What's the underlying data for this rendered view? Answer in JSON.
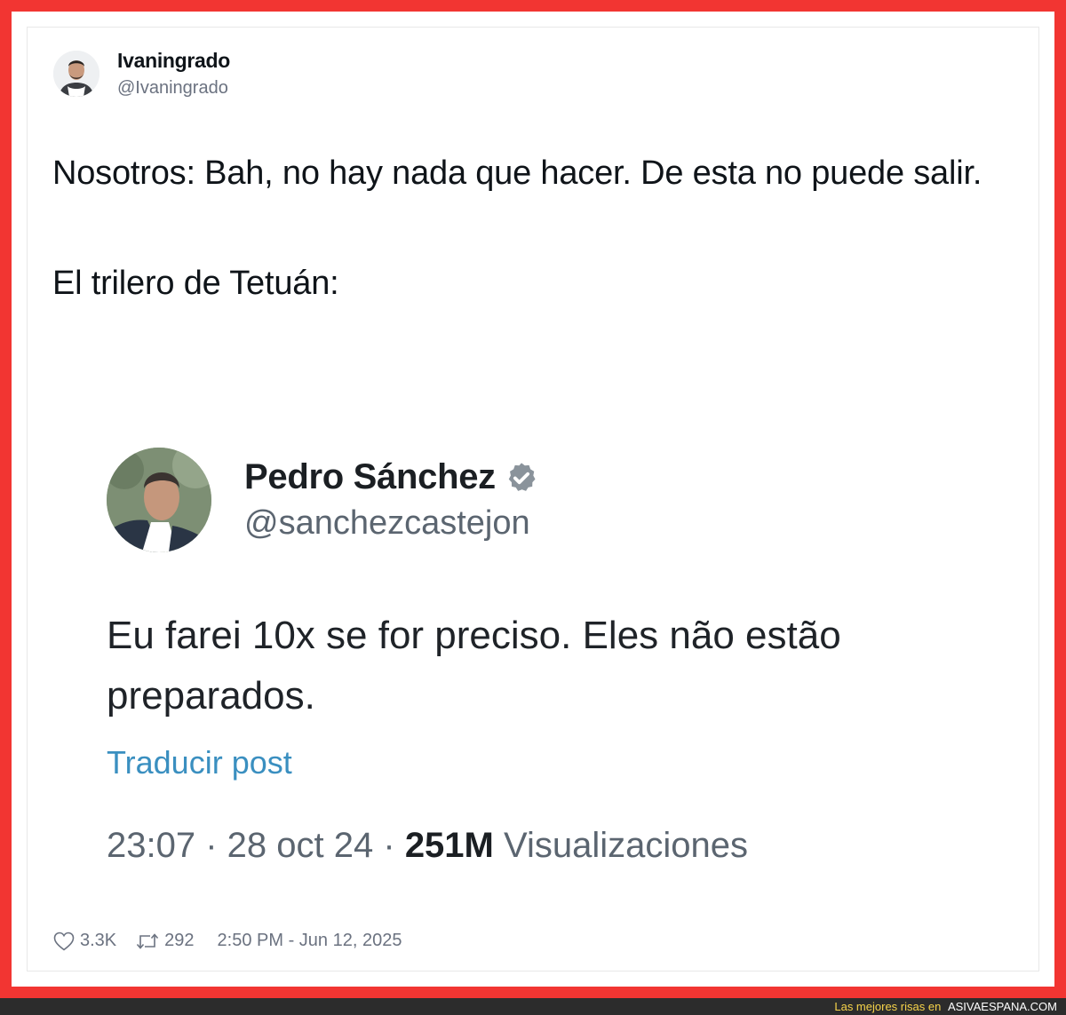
{
  "author": {
    "name": "Ivaningrado",
    "handle": "@Ivaningrado"
  },
  "tweet": {
    "line1": "Nosotros: Bah, no hay nada que hacer. De esta no puede salir.",
    "line2": "El trilero de Tetuán:"
  },
  "embedded_post": {
    "name": "Pedro Sánchez",
    "handle": "@sanchezcastejon",
    "text": "Eu farei 10x se for preciso. Eles não estão preparados.",
    "translate_label": "Traducir post",
    "time": "23:07",
    "date": "28 oct 24",
    "views_count": "251M",
    "views_label": "Visualizaciones",
    "verified_icon": "verified-badge-icon"
  },
  "actions": {
    "likes": "3.3K",
    "retweets": "292",
    "timestamp": "2:50 PM - Jun 12, 2025"
  },
  "footer": {
    "prefix": "Las mejores risas en",
    "site": "ASIVAESPANA.COM"
  },
  "colors": {
    "frame": "#f23532",
    "link": "#3a8fc0",
    "footer_bg": "#2c2c2c",
    "footer_accent": "#f6d34a"
  }
}
